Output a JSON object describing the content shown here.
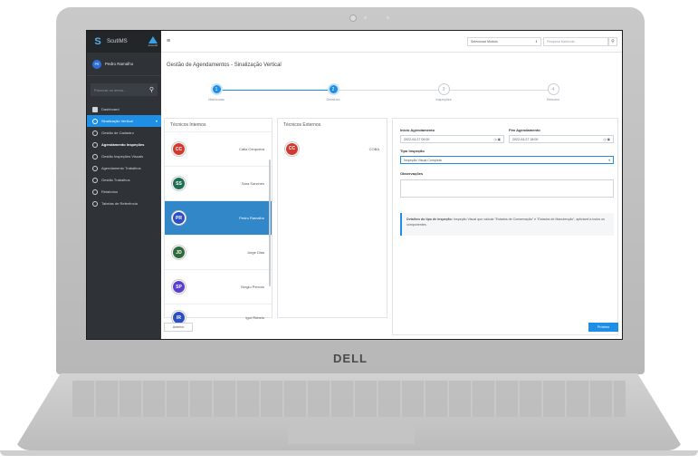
{
  "laptop": {
    "brand": "DELL"
  },
  "sidebar": {
    "app_name": "ScutIMS",
    "company": "ascendi",
    "user": {
      "initials": "PR",
      "name": "Pedro Ramalho"
    },
    "search_placeholder": "Procurar no menu...",
    "items": [
      {
        "label": "Dashboard"
      },
      {
        "label": "Sinalização Vertical"
      },
      {
        "label": "Gestão de Cadastro"
      },
      {
        "label": "Agendamento Inspeções"
      },
      {
        "label": "Gestão Inspeções Visuais"
      },
      {
        "label": "Agendamento Trabalhos"
      },
      {
        "label": "Gestão Trabalhos"
      },
      {
        "label": "Relatórios"
      },
      {
        "label": "Tabelas de Referência"
      }
    ]
  },
  "topbar": {
    "menu_icon": "≡",
    "module_select": "Selecionar Módulo",
    "search_placeholder": "Pesquisa Matrícula",
    "notification_icon": "bell-icon",
    "user_icon": "user-icon"
  },
  "page": {
    "title": "Gestão de Agendamentos - Sinalização Vertical"
  },
  "steps": [
    {
      "n": "1",
      "label": "Matrículas"
    },
    {
      "n": "2",
      "label": "Detalhes"
    },
    {
      "n": "3",
      "label": "Inspeções"
    },
    {
      "n": "4",
      "label": "Resumo"
    }
  ],
  "internos": {
    "title": "Técnicos Internos",
    "items": [
      {
        "initials": "CC",
        "name": "Cátia Cerqueira",
        "color": "#d23a2f"
      },
      {
        "initials": "SS",
        "name": "Sara Sanches",
        "color": "#1f6f55"
      },
      {
        "initials": "PR",
        "name": "Pedro Ramalho",
        "color": "#2e4fc4"
      },
      {
        "initials": "JD",
        "name": "Jorge Dias",
        "color": "#2d6a3c"
      },
      {
        "initials": "SP",
        "name": "Sérgio Peixoto",
        "color": "#5a3fd0"
      },
      {
        "initials": "IR",
        "name": "Igor Rebelo",
        "color": "#2e4fc4"
      }
    ]
  },
  "externos": {
    "title": "Técnicos Externos",
    "items": [
      {
        "initials": "CC",
        "name": "COBA",
        "color": "#d23a2f"
      }
    ]
  },
  "form": {
    "inicio_label": "Início Agendamento",
    "inicio_value": "2022-04-27 09:00",
    "fim_label": "Fim Agendamento",
    "fim_value": "2022-04-27 18:00",
    "tipo_label": "Tipo Inspeção",
    "tipo_value": "Inspeção Visual Completa",
    "obs_label": "Observações",
    "note_bold": "Detalhes do tipo de inspeção:",
    "note_text": " Inspeção Visual que calcula \"Estados de Conservação\" e \"Estados de Manutenção\", aplicável a todos os componentes."
  },
  "buttons": {
    "prev": "Anterior",
    "next": "Próximo"
  }
}
